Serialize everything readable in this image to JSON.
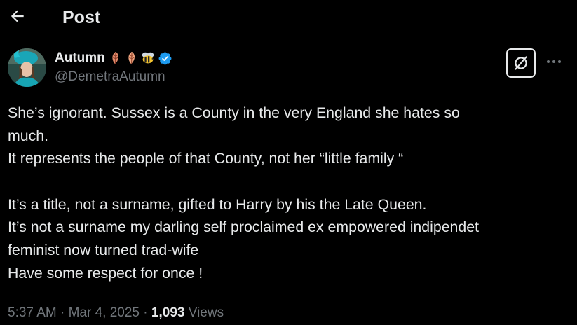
{
  "header": {
    "title": "Post"
  },
  "author": {
    "name": "Autumn",
    "handle": "@DemetraAutumn"
  },
  "tweet": {
    "lines": [
      "She’s ignorant. Sussex is a County in the very England she hates so",
      "much.",
      "It represents the people of that County, not her “little family “",
      "",
      "It’s a title, not a surname, gifted to Harry by his the Late Queen.",
      "It’s not a surname my darling self proclaimed ex empowered indipendet",
      "feminist now turned trad-wife",
      "Have some respect for once !"
    ]
  },
  "meta": {
    "time": "5:37 AM",
    "separator": "·",
    "date": "Mar 4, 2025",
    "views_count": "1,093",
    "views_label": "Views"
  },
  "icons": {
    "back": "arrow-left-icon",
    "emoji_1": "leaf-icon",
    "emoji_2": "leaf-icon",
    "emoji_3": "bee-icon",
    "verified": "verified-badge-icon",
    "grok": "grok-icon",
    "more": "more-horizontal-icon"
  },
  "colors": {
    "background": "#000000",
    "primary_text": "#e7e9ea",
    "secondary_text": "#71767b",
    "verified_blue": "#1d9bf0"
  }
}
